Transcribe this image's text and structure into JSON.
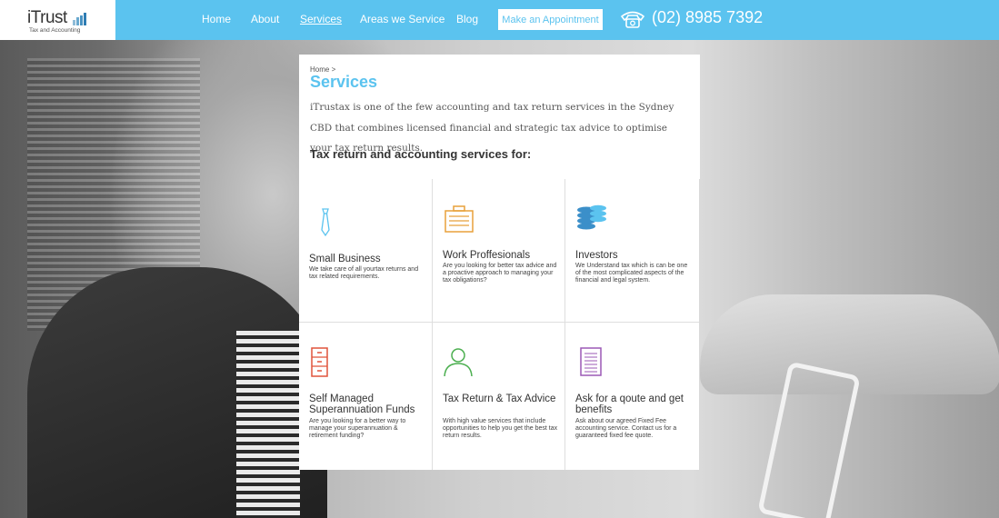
{
  "brand": {
    "name": "iTrust",
    "tagline": "Tax and Accounting"
  },
  "nav": {
    "items": [
      "Home",
      "About",
      "Services",
      "Areas we Service",
      "Blog"
    ],
    "active": "Services",
    "appointment_label": "Make an Appointment",
    "phone": "(02) 8985 7392"
  },
  "page": {
    "breadcrumb": "Home >",
    "title": "Services",
    "intro": "iTrustax is one of the few accounting and tax return services in the Sydney CBD that combines licensed financial and strategic tax advice to optimise your tax return results.",
    "subheading": "Tax return and accounting services for:"
  },
  "services": [
    {
      "title": "Small Business",
      "description": "We take care of all yourtax returns and tax related requirements.",
      "icon": "tie-icon",
      "color": "#5bc3ef"
    },
    {
      "title": "Work Proffesionals",
      "description": "Are you looking for better tax advice and a proactive approach to managing your tax obligations?",
      "icon": "briefcase-icon",
      "color": "#e8a13a"
    },
    {
      "title": "Investors",
      "description": "We Understand tax which is can be one of the most complicated aspects of the financial and legal system.",
      "icon": "coins-icon",
      "color": "#3b8fc9"
    },
    {
      "title": "Self Managed Superannuation Funds",
      "description": "Are you looking for a better way to manage your superannuation & retirement funding?",
      "icon": "filing-cabinet-icon",
      "color": "#e0533b"
    },
    {
      "title": "Tax Return & Tax Advice",
      "description": "With high value services that include opportunities to help you get the best tax return results.",
      "icon": "user-icon",
      "color": "#4caf50"
    },
    {
      "title": "Ask for a qoute and get benefits",
      "description": "Ask about our agreed Fixed Fee accounting service. Contact us for a guaranteed fixed fee quote.",
      "icon": "document-icon",
      "color": "#9b59b6"
    }
  ]
}
